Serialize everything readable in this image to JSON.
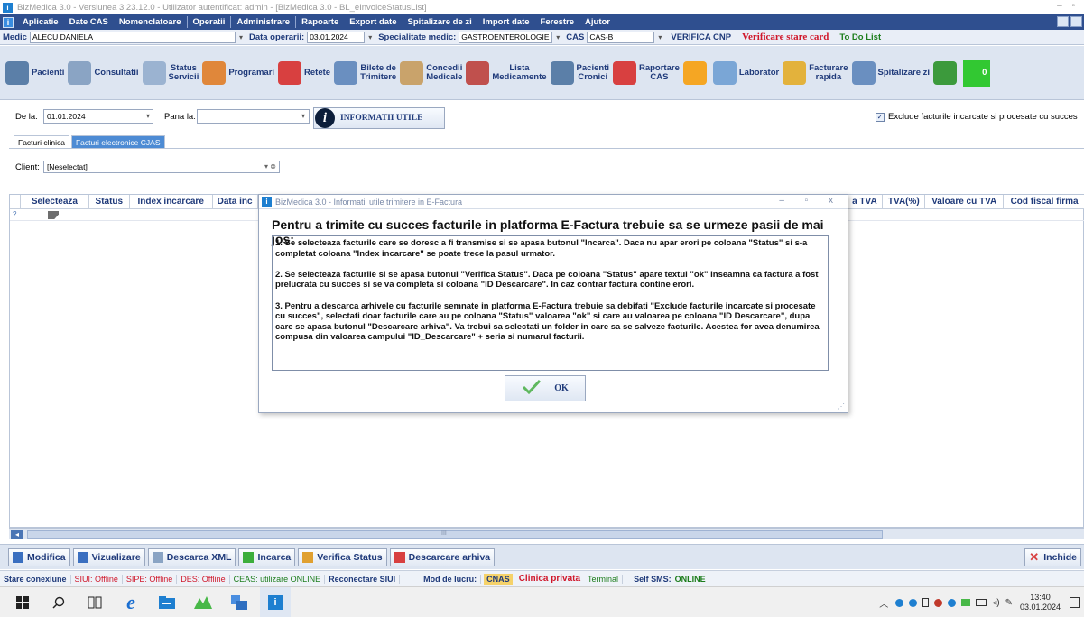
{
  "window": {
    "title": "BizMedica 3.0 - Versiunea 3.23.12.0 - Utilizator autentificat: admin - [BizMedica 3.0 - BL_eInvoiceStatusList]",
    "controls": "– ▫"
  },
  "menu": [
    "Aplicatie",
    "Date CAS",
    "Nomenclatoare",
    "Operatii",
    "Administrare",
    "Rapoarte",
    "Export date",
    "Spitalizare de zi",
    "Import date",
    "Ferestre",
    "Ajutor"
  ],
  "filter": {
    "medic_label": "Medic",
    "medic_value": "ALECU DANIELA",
    "data_label": "Data operarii:",
    "data_value": "03.01.2024",
    "spec_label": "Specialitate medic:",
    "spec_value": "GASTROENTEROLOGIE",
    "cas_label": "CAS",
    "cas_value": "CAS-B",
    "verifica_cnp": "VERIFICA CNP",
    "verificare_card": "Verificare stare card",
    "todo": "To Do List",
    "dropdown_glyph": "▾"
  },
  "toolbar": [
    {
      "label": "Pacienti",
      "icon": "patients-icon",
      "color": "#5b7fa8"
    },
    {
      "label": "Consultatii",
      "icon": "stethoscope-icon",
      "color": "#8aa4c4"
    },
    {
      "label": "Status\nServicii",
      "icon": "status-pencil-icon",
      "color": "#9bb3d1"
    },
    {
      "label": "Programari",
      "icon": "calendar-icon",
      "color": "#e0873a"
    },
    {
      "label": "Retete",
      "icon": "prescription-icon",
      "color": "#d84040"
    },
    {
      "label": "Bilete de\nTrimitere",
      "icon": "referral-icon",
      "color": "#6a8fc0"
    },
    {
      "label": "Concedii\nMedicale",
      "icon": "medical-leave-icon",
      "color": "#c9a36b"
    },
    {
      "label": "Lista\nMedicamente",
      "icon": "pills-icon",
      "color": "#c0504d"
    },
    {
      "label": "Pacienti\nCronici",
      "icon": "chronic-patients-icon",
      "color": "#5b7fa8"
    },
    {
      "label": "Raportare\nCAS",
      "icon": "report-cas-icon",
      "color": "#d84040"
    },
    {
      "label": "",
      "icon": "warning-icon",
      "color": "#f5a623"
    },
    {
      "label": "Laborator",
      "icon": "laboratory-icon",
      "color": "#7aa6d6"
    },
    {
      "label": "Facturare\nrapida",
      "icon": "quick-invoice-icon",
      "color": "#e3b23c"
    },
    {
      "label": "Spitalizare zi",
      "icon": "hospital-day-icon",
      "color": "#6a8fc0"
    },
    {
      "label": "",
      "icon": "cart-icon",
      "color": "#3c9a3c"
    },
    {
      "label": "0",
      "icon": "phone-icon",
      "color": "#32c832"
    }
  ],
  "dates": {
    "de_la_label": "De la:",
    "de_la_value": "01.01.2024",
    "pana_la_label": "Pana la:",
    "pana_la_value": "",
    "info_button": "INFORMATII UTILE",
    "exclude_label": "Exclude facturile incarcate si procesate cu succes",
    "exclude_checked": true
  },
  "tabs": [
    "Facturi clinica",
    "Facturi electronice CJAS"
  ],
  "client": {
    "label": "Client:",
    "value": "[Neselectat]"
  },
  "grid": {
    "columns": [
      "Selecteaza",
      "Status",
      "Index incarcare",
      "Data inc",
      "a TVA",
      "TVA(%)",
      "Valoare cu TVA",
      "Cod fiscal firma"
    ],
    "row_marker": "?"
  },
  "scroll_glyph": "III",
  "bottom_buttons": [
    {
      "label": "Modifica",
      "icon": "edit-icon",
      "color": "#3a6fc0"
    },
    {
      "label": "Vizualizare",
      "icon": "view-icon",
      "color": "#3a6fc0"
    },
    {
      "label": "Descarca XML",
      "icon": "xml-download-icon",
      "color": "#8aa4c4"
    },
    {
      "label": "Incarca",
      "icon": "upload-icon",
      "color": "#3cae3c"
    },
    {
      "label": "Verifica Status",
      "icon": "verify-status-icon",
      "color": "#e0a030"
    },
    {
      "label": "Descarcare arhiva",
      "icon": "archive-download-icon",
      "color": "#d84040"
    }
  ],
  "close_button": "Inchide",
  "statusbar": {
    "stare": "Stare conexiune",
    "siui": "SIUI: Offline",
    "sipe": "SIPE: Offline",
    "des": "DES: Offline",
    "ceas": "CEAS: utilizare ONLINE",
    "reconectare": "Reconectare SIUI",
    "mod": "Mod de lucru:",
    "cnas": "CNAS",
    "clinica": "Clinica privata",
    "terminal": "Terminal",
    "sms": "Self SMS:",
    "online": "ONLINE"
  },
  "dialog": {
    "title": "BizMedica 3.0 - Informatii utile trimitere in E-Factura",
    "controls": "– ▫ x",
    "heading": "Pentru a trimite cu succes facturile in platforma E-Factura trebuie sa se urmeze pasii de mai jos:",
    "paragraphs": [
      "1. Se selecteaza facturile care se doresc a fi transmise si se apasa butonul \"Incarca\". Daca nu apar erori pe coloana \"Status\" si s-a completat coloana \"Index incarcare\" se poate trece la pasul urmator.",
      "2. Se selecteaza facturile si se apasa butonul \"Verifica Status\". Daca pe coloana \"Status\" apare textul \"ok\" inseamna ca factura a fost prelucrata cu succes si se va completa si coloana \"ID Descarcare\". In caz contrar factura contine erori.",
      "3. Pentru a descarca arhivele cu facturile semnate in platforma E-Factura trebuie sa debifati \"Exclude facturile incarcate si procesate cu succes\", selectati doar facturile care au pe coloana \"Status\" valoarea \"ok\" si care au valoarea pe coloana \"ID Descarcare\", dupa care se apasa butonul \"Descarcare arhiva\". Va trebui sa selectati un folder in care sa se salveze facturile. Acestea for avea denumirea compusa din valoarea campului \"ID_Descarcare\" + seria si numarul facturii."
    ],
    "ok_label": "OK"
  },
  "taskbar": {
    "time": "13:40",
    "date": "03.01.2024",
    "icons": [
      "windows-start-icon",
      "search-icon",
      "task-view-icon",
      "edge-icon",
      "file-explorer-icon",
      "app-icon",
      "app-window-icon",
      "bizmedica-icon"
    ]
  }
}
